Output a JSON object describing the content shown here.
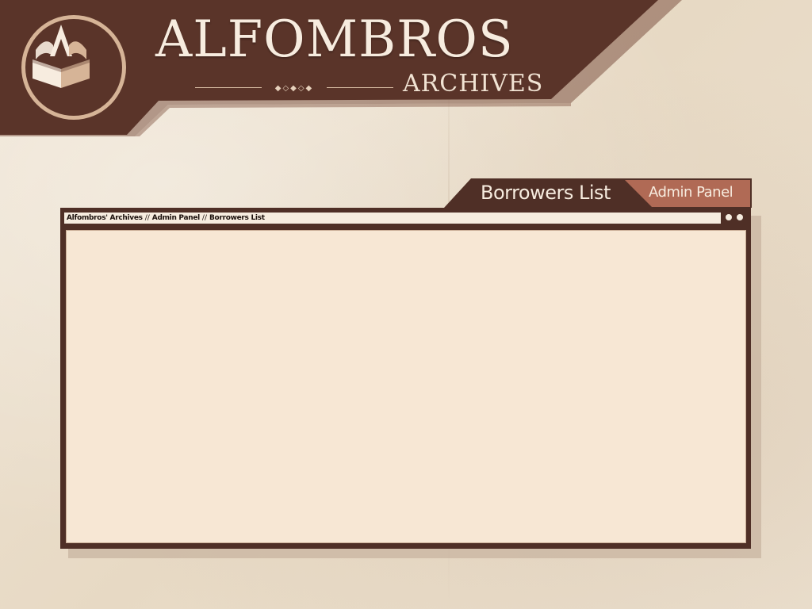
{
  "brand": {
    "title": "ALFOMBROS",
    "subtitle": "ARCHIVES",
    "logo_icon": "open-book-letter-a-icon"
  },
  "window": {
    "tabs": [
      {
        "label": "Borrowers List",
        "active": true
      },
      {
        "label": "Admin Panel",
        "active": false
      }
    ],
    "breadcrumb": [
      "Alfombros' Archives",
      "Admin Panel",
      "Borrowers List"
    ],
    "breadcrumb_separator": "//",
    "controls": [
      "dot-icon",
      "dot-icon"
    ]
  },
  "colors": {
    "banner_dark": "#5a3429",
    "banner_mid": "#7d5343",
    "tab_admin": "#b06a55",
    "window_frame": "#4f2f26",
    "content_bg": "#f7e7d4",
    "cream_text": "#f7ecdf",
    "logo_ring": "#d6b497"
  }
}
